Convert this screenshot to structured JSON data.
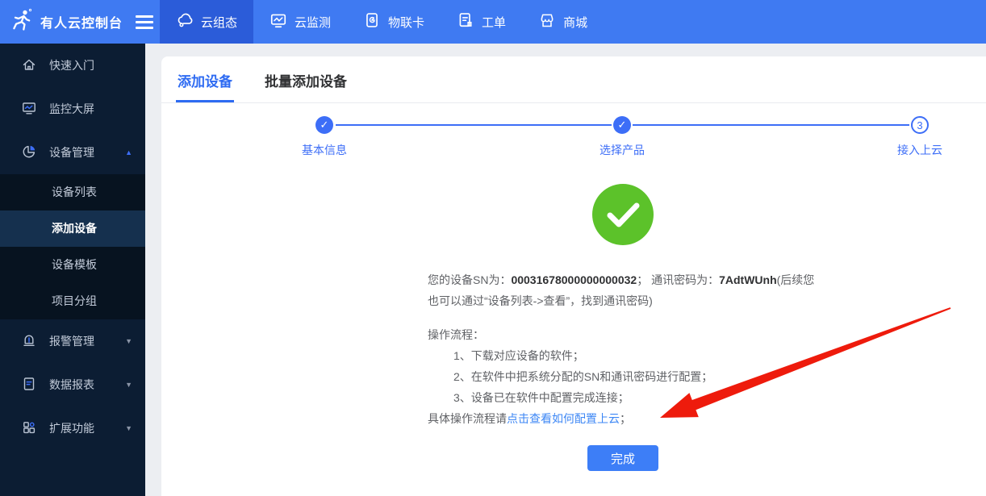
{
  "topbar": {
    "brand": "有人云控制台",
    "nav": [
      {
        "label": "云组态",
        "icon": "cloud-icon",
        "active": true
      },
      {
        "label": "云监测",
        "icon": "monitor-icon",
        "active": false
      },
      {
        "label": "物联卡",
        "icon": "sim-card-icon",
        "active": false
      },
      {
        "label": "工单",
        "icon": "work-order-icon",
        "active": false
      },
      {
        "label": "商城",
        "icon": "store-icon",
        "active": false
      }
    ]
  },
  "sidebar": {
    "items": [
      {
        "label": "快速入门",
        "icon": "home-icon"
      },
      {
        "label": "监控大屏",
        "icon": "big-screen-icon"
      },
      {
        "label": "设备管理",
        "icon": "device-pie-icon",
        "expanded": true,
        "caret": "▲"
      },
      {
        "label": "报警管理",
        "icon": "alarm-icon",
        "caret": "▼"
      },
      {
        "label": "数据报表",
        "icon": "report-icon",
        "caret": "▼"
      },
      {
        "label": "扩展功能",
        "icon": "extension-icon",
        "caret": "▼"
      }
    ],
    "device_children": [
      {
        "label": "设备列表",
        "selected": false
      },
      {
        "label": "添加设备",
        "selected": true
      },
      {
        "label": "设备模板",
        "selected": false
      },
      {
        "label": "项目分组",
        "selected": false
      }
    ]
  },
  "main": {
    "tabs": [
      {
        "label": "添加设备",
        "active": true
      },
      {
        "label": "批量添加设备",
        "active": false
      }
    ],
    "steps": [
      {
        "label": "基本信息",
        "status": "done",
        "glyph": "✓"
      },
      {
        "label": "选择产品",
        "status": "done",
        "glyph": "✓"
      },
      {
        "label": "接入上云",
        "status": "current",
        "glyph": "3"
      }
    ],
    "result": {
      "sn_label": "您的设备SN为：",
      "sn_value": "00031678000000000032",
      "pwd_label": "；  通讯密码为：",
      "pwd_value": "7AdtWUnh",
      "pwd_note": "(后续您也可以通过“设备列表->查看”，找到通讯密码)",
      "process_title": "操作流程：",
      "process_items": [
        "1、下载对应设备的软件；",
        "2、在软件中把系统分配的SN和通讯密码进行配置；",
        "3、设备已在软件中配置完成连接；"
      ],
      "more_prefix": "具体操作流程请",
      "more_link": "点击查看如何配置上云",
      "more_suffix": "；",
      "finish_label": "完成"
    }
  },
  "colors": {
    "topbar_blue": "#3F7AF2",
    "topbar_active_blue": "#2B5CD9",
    "sidebar_navy": "#0C1D33",
    "submenu_navy": "#071320",
    "selected_navy": "#15304E",
    "accent_blue": "#3D6EF7",
    "link_blue": "#3D87F5",
    "success_green": "#5CC22A",
    "button_blue": "#3D7EF7",
    "annotation_red": "#EE1B0C"
  }
}
